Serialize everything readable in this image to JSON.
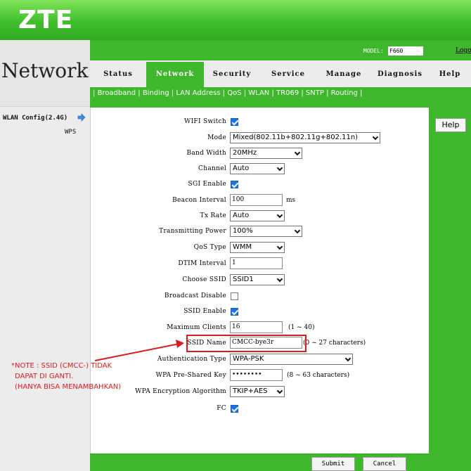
{
  "brand": {
    "logo": "ZTE"
  },
  "header": {
    "section_title": "Network",
    "model_label": "MODEL:",
    "model_value": "F660",
    "logout_label": "Logo"
  },
  "tabs": [
    {
      "label": "Status",
      "active": false
    },
    {
      "label": "Network",
      "active": true
    },
    {
      "label": "Security",
      "active": false
    },
    {
      "label": "Service",
      "active": false
    },
    {
      "label": "Manage",
      "active": false
    },
    {
      "label": "Diagnosis",
      "active": false
    },
    {
      "label": "Help",
      "active": false
    }
  ],
  "subnav": {
    "items": [
      "Broadband",
      "Binding",
      "LAN Address",
      "QoS",
      "WLAN",
      "TR069",
      "SNTP",
      "Routing"
    ],
    "active": "WLAN"
  },
  "leftmenu": {
    "items": [
      {
        "label": "WLAN Config(2.4G)",
        "icon": "arrow-right-icon"
      },
      {
        "label": "WPS"
      }
    ]
  },
  "form": {
    "wifi_switch": {
      "label": "WIFI Switch",
      "checked": true
    },
    "mode": {
      "label": "Mode",
      "value": "Mixed(802.11b+802.11g+802.11n)"
    },
    "band_width": {
      "label": "Band Width",
      "value": "20MHz"
    },
    "channel": {
      "label": "Channel",
      "value": "Auto"
    },
    "sgi_enable": {
      "label": "SGI Enable",
      "checked": true
    },
    "beacon_interval": {
      "label": "Beacon Interval",
      "value": "100",
      "unit": "ms"
    },
    "tx_rate": {
      "label": "Tx Rate",
      "value": "Auto"
    },
    "transmitting_power": {
      "label": "Transmitting Power",
      "value": "100%"
    },
    "qos_type": {
      "label": "QoS Type",
      "value": "WMM"
    },
    "dtim_interval": {
      "label": "DTIM Interval",
      "value": "1"
    },
    "choose_ssid": {
      "label": "Choose SSID",
      "value": "SSID1"
    },
    "broadcast_disable": {
      "label": "Broadcast Disable",
      "checked": false
    },
    "ssid_enable": {
      "label": "SSID Enable",
      "checked": true
    },
    "maximum_clients": {
      "label": "Maximum Clients",
      "value": "16",
      "hint": "(1 ~ 40)"
    },
    "ssid_name": {
      "label": "SSID Name",
      "value": "CMCC-bye3r",
      "hint": "(0 ~ 27 characters)"
    },
    "authentication_type": {
      "label": "Authentication Type",
      "value": "WPA-PSK"
    },
    "wpa_psk": {
      "label": "WPA Pre-Shared Key",
      "value": "••••••••",
      "hint": "(8 ~ 63 characters)"
    },
    "wpa_encryption": {
      "label": "WPA Encryption Algorithm",
      "value": "TKIP+AES"
    },
    "fc": {
      "label": "FC",
      "checked": true
    }
  },
  "help": {
    "label": "Help"
  },
  "buttons": {
    "submit": "Submit",
    "cancel": "Cancel"
  },
  "annotation": {
    "line1": "*NOTE : SSID (CMCC-) TIDAK",
    "line2": "DAPAT DI GANTI.",
    "line3": "(HANYA BISA MENAMBAHKAN)",
    "color": "#e0191b"
  },
  "colors": {
    "brand_green": "#3eb72d",
    "checkbox_blue": "#1a73e8"
  }
}
